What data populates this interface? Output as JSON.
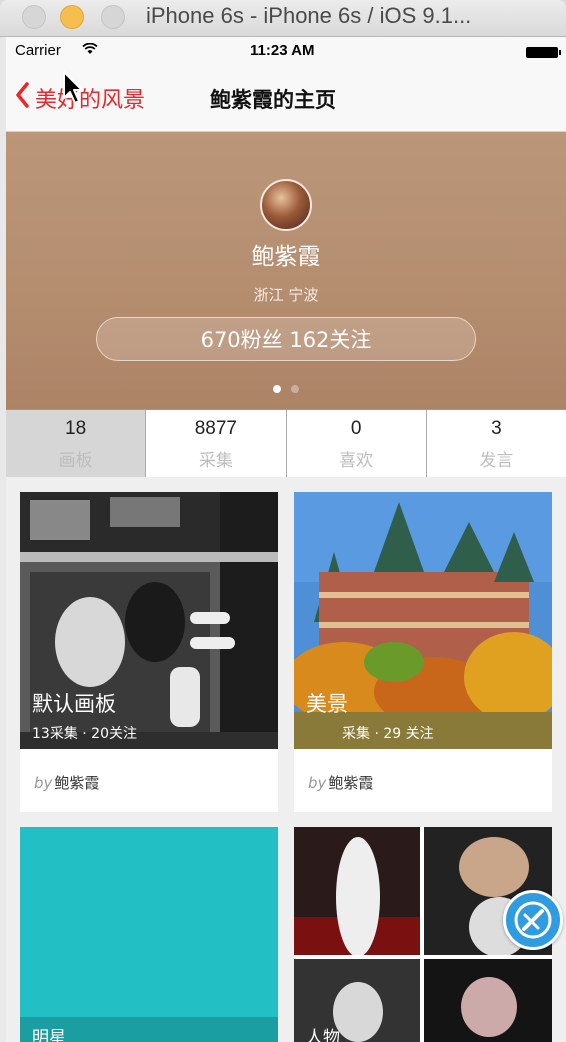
{
  "window": {
    "title": "iPhone 6s - iPhone 6s / iOS 9.1..."
  },
  "status_bar": {
    "carrier": "Carrier",
    "time": "11:23 AM"
  },
  "nav": {
    "back_label": "美好的风景",
    "title": "鲍紫霞的主页"
  },
  "profile": {
    "name": "鲍紫霞",
    "location": "浙江 宁波",
    "follow_text": "670粉丝 162关注",
    "page_count": 2,
    "active_page": 1
  },
  "stats": [
    {
      "value": "18",
      "label": "画板"
    },
    {
      "value": "8877",
      "label": "采集"
    },
    {
      "value": "0",
      "label": "喜欢"
    },
    {
      "value": "3",
      "label": "发言"
    }
  ],
  "boards": [
    {
      "title": "默认画板",
      "stats": "13采集 · 20关注",
      "by": "by",
      "owner": "鲍紫霞"
    },
    {
      "title": "美景",
      "stats": "采集 · 29 关注",
      "by": "by",
      "owner": "鲍紫霞"
    },
    {
      "title": "明星",
      "stats": "",
      "by": "",
      "owner": ""
    },
    {
      "title": "人物",
      "stats": "",
      "by": "",
      "owner": ""
    }
  ],
  "colors": {
    "accent": "#e8262b",
    "hero": "#b58e70",
    "fab": "#2f9be0",
    "teal_board": "#22c0c4"
  },
  "icons": [
    "wifi-icon",
    "battery-icon",
    "back-chevron-icon",
    "pointer-cursor-icon",
    "edit-fab-icon"
  ]
}
